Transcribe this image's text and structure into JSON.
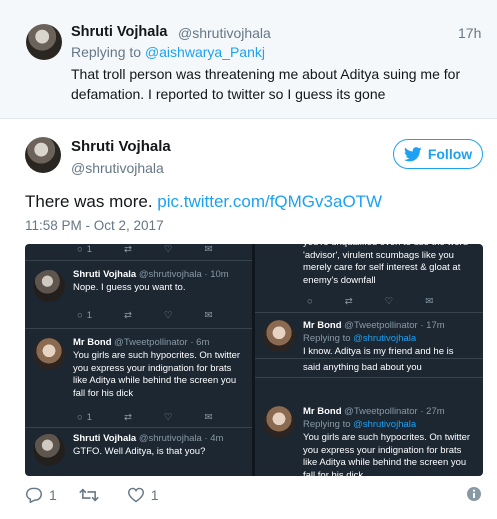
{
  "reply_tweet": {
    "author_name": "Shruti Vojhala",
    "author_handle": "@shrutivojhala",
    "time": "17h",
    "replying_prefix": "Replying to",
    "replying_to": "@aishwarya_Pankj",
    "text": "That troll person was threatening me about Aditya suing me for defamation. I reported to twitter so I guess its gone"
  },
  "main_tweet": {
    "author_name": "Shruti Vojhala",
    "author_handle": "@shrutivojhala",
    "follow_label": "Follow",
    "text": "There was more.",
    "link": "pic.twitter.com/fQMGv3aOTW",
    "timestamp": "11:58 PM - Oct 2, 2017",
    "reply_count": "1",
    "retweet_count": "",
    "like_count": "1"
  },
  "screenshot": {
    "left": {
      "top_reply_count": "1",
      "tweets": [
        {
          "name": "Shruti Vojhala",
          "meta": "@shrutivojhala · 10m",
          "text": "Nope. I guess you want to.",
          "reply_count": "1"
        },
        {
          "name": "Mr Bond",
          "meta": "@Tweetpollinator · 6m",
          "text": "You girls are such hypocrites. On twitter you express your indignation for brats like Aditya while behind the screen you fall for his dick",
          "reply_count": "1"
        },
        {
          "name": "Shruti Vojhala",
          "meta": "@shrutivojhala · 4m",
          "text": "GTFO. Well Aditya, is that you?"
        }
      ]
    },
    "right": {
      "top_text": "you're unqualified even to use the word 'advisor', virulent scumbags like you merely care for self interest & gloat at enemy's downfall",
      "tweets": [
        {
          "name": "Mr Bond",
          "meta": "@Tweetpollinator · 17m",
          "replying_prefix": "Replying to",
          "replying_to": "@shrutivojhala",
          "text": "I know. Aditya is my friend and he is"
        },
        {
          "name": "",
          "meta": "",
          "text": "said anything bad about you"
        },
        {
          "name": "Mr Bond",
          "meta": "@Tweetpollinator · 27m",
          "replying_prefix": "Replying to",
          "replying_to": "@shrutivojhala",
          "text": "You girls are such hypocrites. On twitter you express your indignation for brats like Aditya while behind the screen you fall for his dick"
        }
      ]
    }
  },
  "colors": {
    "accent": "#1da1f2",
    "muted": "#657786",
    "dark_bg": "#1c2732"
  }
}
